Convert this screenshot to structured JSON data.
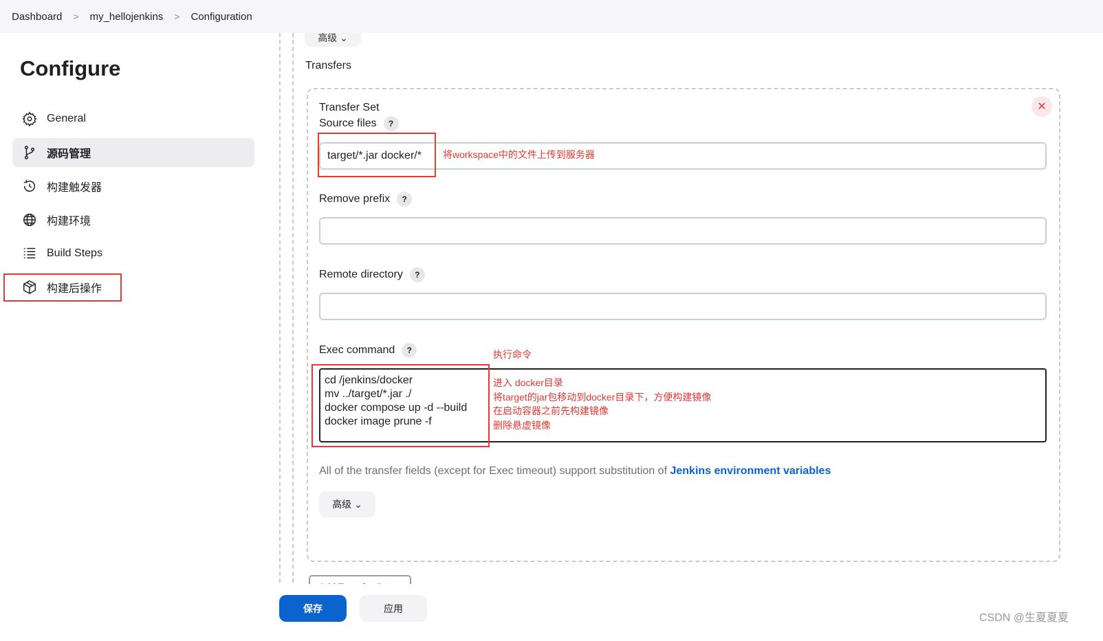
{
  "breadcrumb": [
    "Dashboard",
    "my_hellojenkins",
    "Configuration"
  ],
  "sidebar": {
    "title": "Configure",
    "items": [
      {
        "label": "General",
        "icon": "gear-icon"
      },
      {
        "label": "源码管理",
        "icon": "branch-icon",
        "active": true
      },
      {
        "label": "构建触发器",
        "icon": "clock-icon"
      },
      {
        "label": "构建环境",
        "icon": "globe-icon"
      },
      {
        "label": "Build Steps",
        "icon": "list-icon"
      },
      {
        "label": "构建后操作",
        "icon": "package-icon"
      }
    ]
  },
  "main": {
    "advanced_top": "高级",
    "transfers_label": "Transfers",
    "transfer_set_label": "Transfer Set",
    "source_files": {
      "label": "Source files",
      "value": "target/*.jar docker/*",
      "note": "将workspace中的文件上传到服务器"
    },
    "remove_prefix": {
      "label": "Remove prefix",
      "value": ""
    },
    "remote_directory": {
      "label": "Remote directory",
      "value": ""
    },
    "exec_command": {
      "label": "Exec command",
      "note": "执行命令",
      "lines": [
        "cd /jenkins/docker",
        "mv ../target/*.jar ./",
        "docker compose up -d --build",
        "docker image prune -f"
      ],
      "notes": [
        "进入 docker目录",
        "将target的jar包移动到docker目录下，方便构建镜像",
        "在启动容器之前先构建镜像",
        "删除悬虚镜像"
      ]
    },
    "info_text": "All of the transfer fields (except for Exec timeout) support substitution of ",
    "info_link": "Jenkins environment variables",
    "advanced": "高级",
    "add_transfer_set": "Add Transfer Set"
  },
  "footer": {
    "save": "保存",
    "apply": "应用"
  },
  "watermark": "CSDN @生夏夏夏",
  "colors": {
    "accent": "#0b63ce",
    "annotation": "#e53935"
  }
}
